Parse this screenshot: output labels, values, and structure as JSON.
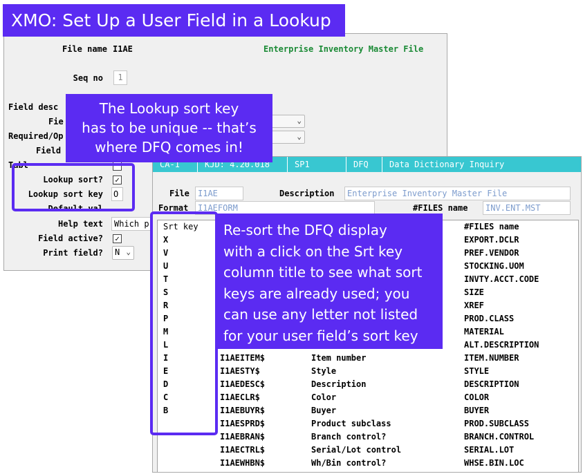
{
  "banner": {
    "title": "XMO: Set Up a User Field in a Lookup"
  },
  "back_form": {
    "file_name_label": "File name",
    "file_name_value": "I1AE",
    "file_description": "Enterprise Inventory Master File",
    "seq_no_label": "Seq no",
    "seq_no_value": "1",
    "field_desc_label": "Field desc",
    "field_label": "Fie",
    "required_label": "Required/Op",
    "field2_label": "Field",
    "table_label": "Tabl",
    "lookup_sort_label": "Lookup sort?",
    "lookup_sort_checked": "✓",
    "lookup_sort_key_label": "Lookup sort key",
    "lookup_sort_key_value": "O",
    "default_label": "Default val",
    "help_text_label": "Help text",
    "help_text_value": "Which p",
    "field_active_label": "Field active?",
    "field_active_checked": "✓",
    "print_field_label": "Print field?",
    "print_field_value": "N"
  },
  "front_window": {
    "tabs": [
      "CA-1",
      "KJD: 4.20.018",
      "SP1",
      "DFQ",
      "Data Dictionary Inquiry"
    ],
    "file_label": "File",
    "file_value": "I1AE",
    "description_label": "Description",
    "description_value": "Enterprise Inventory Master File",
    "format_label": "Format",
    "format_value": "I1AEFORM",
    "files_name_label": "#FILES name",
    "files_name_value": "INV.ENT.MST",
    "grid": {
      "headers": {
        "sort_key": "Srt key",
        "files_name": "#FILES name"
      },
      "sort_key_rows": [
        {
          "key": "X",
          "files": "EXPORT.DCLR"
        },
        {
          "key": "V",
          "files": "PREF.VENDOR"
        },
        {
          "key": "U",
          "files": "STOCKING.UOM"
        },
        {
          "key": "T",
          "files": "INVTY.ACCT.CODE"
        },
        {
          "key": "S",
          "files": "SIZE"
        },
        {
          "key": "R",
          "files": "XREF"
        },
        {
          "key": "P",
          "files": "PROD.CLASS"
        },
        {
          "key": "M",
          "files": "MATERIAL"
        },
        {
          "key": "L",
          "files": "ALT.DESCRIPTION"
        }
      ],
      "full_rows": [
        {
          "key": "I",
          "field": "I1AEITEM$",
          "desc": "Item number",
          "files": "ITEM.NUMBER"
        },
        {
          "key": "E",
          "field": "I1AESTY$",
          "desc": "Style",
          "files": "STYLE"
        },
        {
          "key": "D",
          "field": "I1AEDESC$",
          "desc": "Description",
          "files": "DESCRIPTION"
        },
        {
          "key": "C",
          "field": "I1AECLR$",
          "desc": "Color",
          "files": "COLOR"
        },
        {
          "key": "B",
          "field": "I1AEBUYR$",
          "desc": "Buyer",
          "files": "BUYER"
        },
        {
          "key": "",
          "field": "I1AESPRD$",
          "desc": "Product subclass",
          "files": "PROD.SUBCLASS"
        },
        {
          "key": "",
          "field": "I1AEBRAN$",
          "desc": "Branch control?",
          "files": "BRANCH.CONTROL"
        },
        {
          "key": "",
          "field": "I1AECTRL$",
          "desc": "Serial/Lot control",
          "files": "SERIAL.LOT"
        },
        {
          "key": "",
          "field": "I1AEWHBN$",
          "desc": "Wh/Bin control?",
          "files": "WHSE.BIN.LOC"
        }
      ]
    }
  },
  "callouts": {
    "lookup_key": [
      "The Lookup sort key",
      "has to be unique -- that’s",
      "where DFQ comes in!"
    ],
    "resort": [
      "Re-sort the DFQ display",
      "with a click on the Srt key",
      "column title to see what sort",
      "keys are already used; you",
      "can use any letter not listed",
      "for your user field’s sort key"
    ]
  },
  "colors": {
    "accent": "#5b2bf2",
    "tabbar": "#38c7d1",
    "file_desc_green": "#1a8a35",
    "field_value_blue": "#7d9ccd"
  }
}
